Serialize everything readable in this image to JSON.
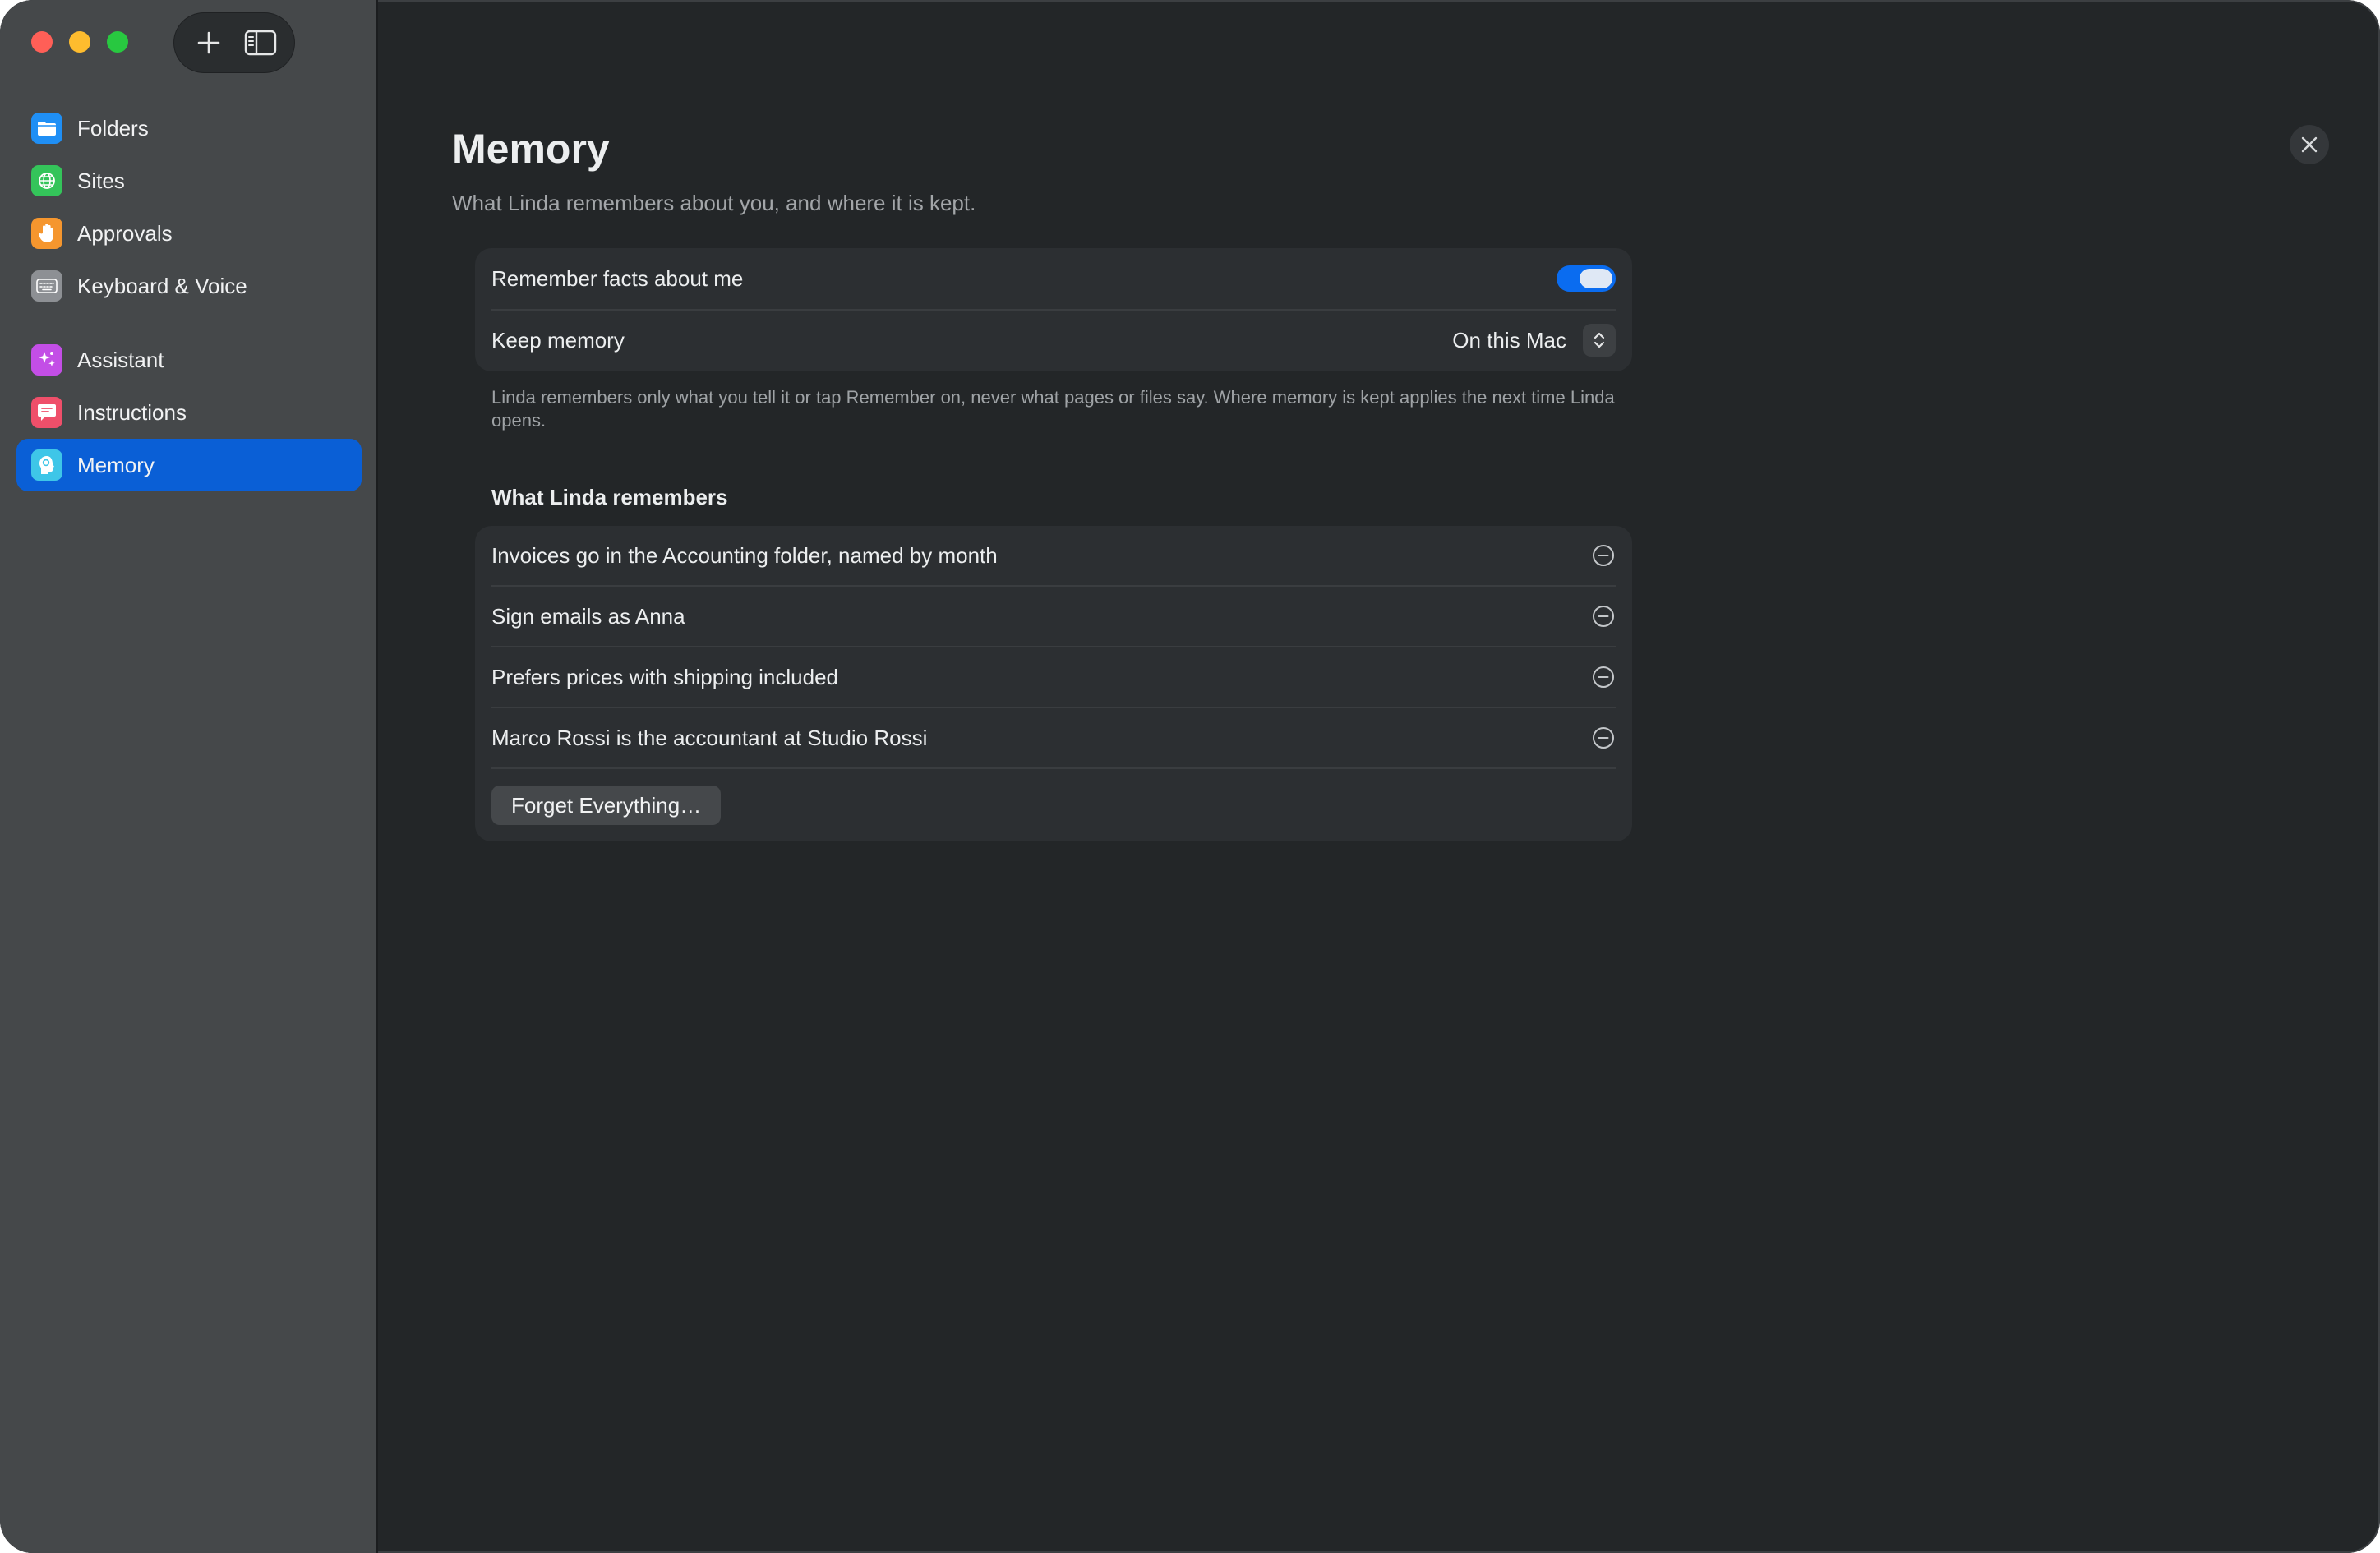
{
  "sidebar": {
    "groups": [
      [
        {
          "label": "Folders",
          "icon": "folder-icon",
          "color": "#1f8ff5"
        },
        {
          "label": "Sites",
          "icon": "globe-icon",
          "color": "#34c45a"
        },
        {
          "label": "Approvals",
          "icon": "hand-icon",
          "color": "#f5962e"
        },
        {
          "label": "Keyboard & Voice",
          "icon": "keyboard-icon",
          "color": "#8d9094"
        }
      ],
      [
        {
          "label": "Assistant",
          "icon": "sparkles-icon",
          "color": "#c34ee6"
        },
        {
          "label": "Instructions",
          "icon": "speech-bubble-icon",
          "color": "#ef4f6a"
        },
        {
          "label": "Memory",
          "icon": "brain-head-icon",
          "color": "#3ec6e8",
          "active": true
        }
      ]
    ]
  },
  "page": {
    "title": "Memory",
    "subtitle": "What Linda remembers about you, and where it is kept."
  },
  "settings": {
    "remember_label": "Remember facts about me",
    "remember_on": true,
    "keep_label": "Keep memory",
    "keep_value": "On this Mac"
  },
  "footnote": "Linda remembers only what you tell it or tap Remember on, never what pages or files say. Where memory is kept applies the next time Linda opens.",
  "memories": {
    "heading": "What Linda remembers",
    "items": [
      "Invoices go in the Accounting folder, named by month",
      "Sign emails as Anna",
      "Prefers prices with shipping included",
      "Marco Rossi is the accountant at Studio Rossi"
    ],
    "forget_label": "Forget Everything…"
  }
}
